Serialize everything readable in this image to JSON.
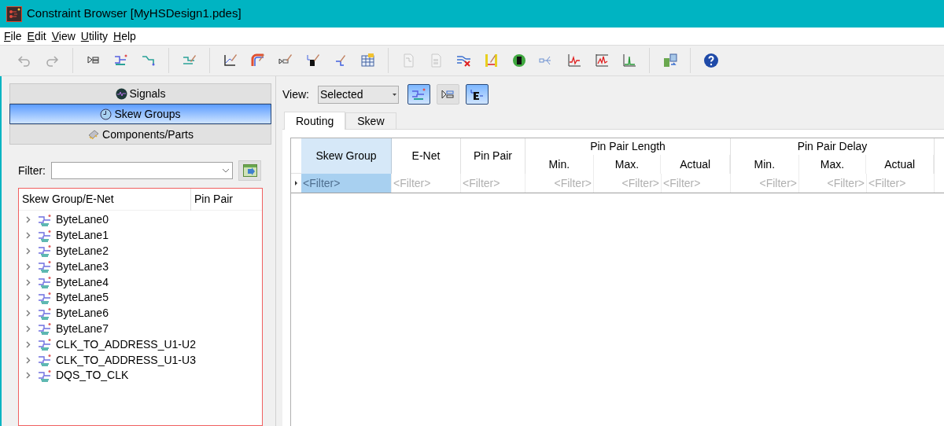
{
  "window": {
    "title": "Constraint Browser [MyHSDesign1.pdes]"
  },
  "menu": [
    "File",
    "Edit",
    "View",
    "Utility",
    "Help"
  ],
  "toolbar": [
    [
      {
        "disabled": true
      },
      {
        "disabled": true
      }
    ],
    [
      {
        "disabled": false
      },
      {
        "disabled": false
      },
      {
        "disabled": false
      }
    ],
    [
      {
        "disabled": false
      }
    ],
    [
      {
        "disabled": false
      },
      {
        "disabled": false
      },
      {
        "disabled": false
      },
      {
        "disabled": false
      },
      {
        "disabled": false
      },
      {
        "disabled": false
      }
    ],
    [
      {
        "disabled": true
      },
      {
        "disabled": true
      },
      {
        "disabled": false
      },
      {
        "disabled": false
      },
      {
        "disabled": false
      },
      {
        "disabled": false
      },
      {
        "disabled": false
      },
      {
        "disabled": false
      },
      {
        "disabled": false
      }
    ],
    [
      {
        "disabled": false
      }
    ],
    [
      {
        "disabled": false
      }
    ]
  ],
  "sidebar": {
    "sections": [
      {
        "label": "Signals",
        "selected": false
      },
      {
        "label": "Skew Groups",
        "selected": true
      },
      {
        "label": "Components/Parts",
        "selected": false
      }
    ],
    "filter": {
      "label": "Filter:"
    },
    "tree": {
      "columns": [
        "Skew Group/E-Net",
        "Pin Pair"
      ],
      "items": [
        {
          "label": "ByteLane0",
          "expanded": false
        },
        {
          "label": "ByteLane1",
          "expanded": false
        },
        {
          "label": "ByteLane2",
          "expanded": false
        },
        {
          "label": "ByteLane3",
          "expanded": false
        },
        {
          "label": "ByteLane4",
          "expanded": false
        },
        {
          "label": "ByteLane5",
          "expanded": false
        },
        {
          "label": "ByteLane6",
          "expanded": false
        },
        {
          "label": "ByteLane7",
          "expanded": false
        },
        {
          "label": "CLK_TO_ADDRESS_U1-U2",
          "expanded": false
        },
        {
          "label": "CLK_TO_ADDRESS_U1-U3",
          "expanded": false
        },
        {
          "label": "DQS_TO_CLK",
          "expanded": false
        }
      ]
    }
  },
  "view_bar": {
    "label": "View:",
    "value": "Selected",
    "toggles": [
      {
        "on": true
      },
      {
        "on": false
      },
      {
        "on": true
      }
    ]
  },
  "tabs": [
    {
      "label": "Routing",
      "selected": true
    },
    {
      "label": "Skew",
      "selected": false
    }
  ],
  "table": {
    "columns": [
      {
        "label": "Skew Group",
        "selected": true
      },
      {
        "label": "E-Net",
        "selected": false
      },
      {
        "label": "Pin Pair",
        "selected": false
      },
      {
        "group": "Pin Pair Length",
        "columns": [
          "Min.",
          "Max.",
          "Actual"
        ]
      },
      {
        "group": "Pin Pair Delay",
        "columns": [
          "Min.",
          "Max.",
          "Actual"
        ]
      }
    ],
    "filter_row": [
      "<Filter>",
      "<Filter>",
      "<Filter>",
      "<Filter>",
      "<Filter>",
      "<Filter>",
      "<Filter>",
      "<Filter>",
      "<Filter>"
    ]
  }
}
